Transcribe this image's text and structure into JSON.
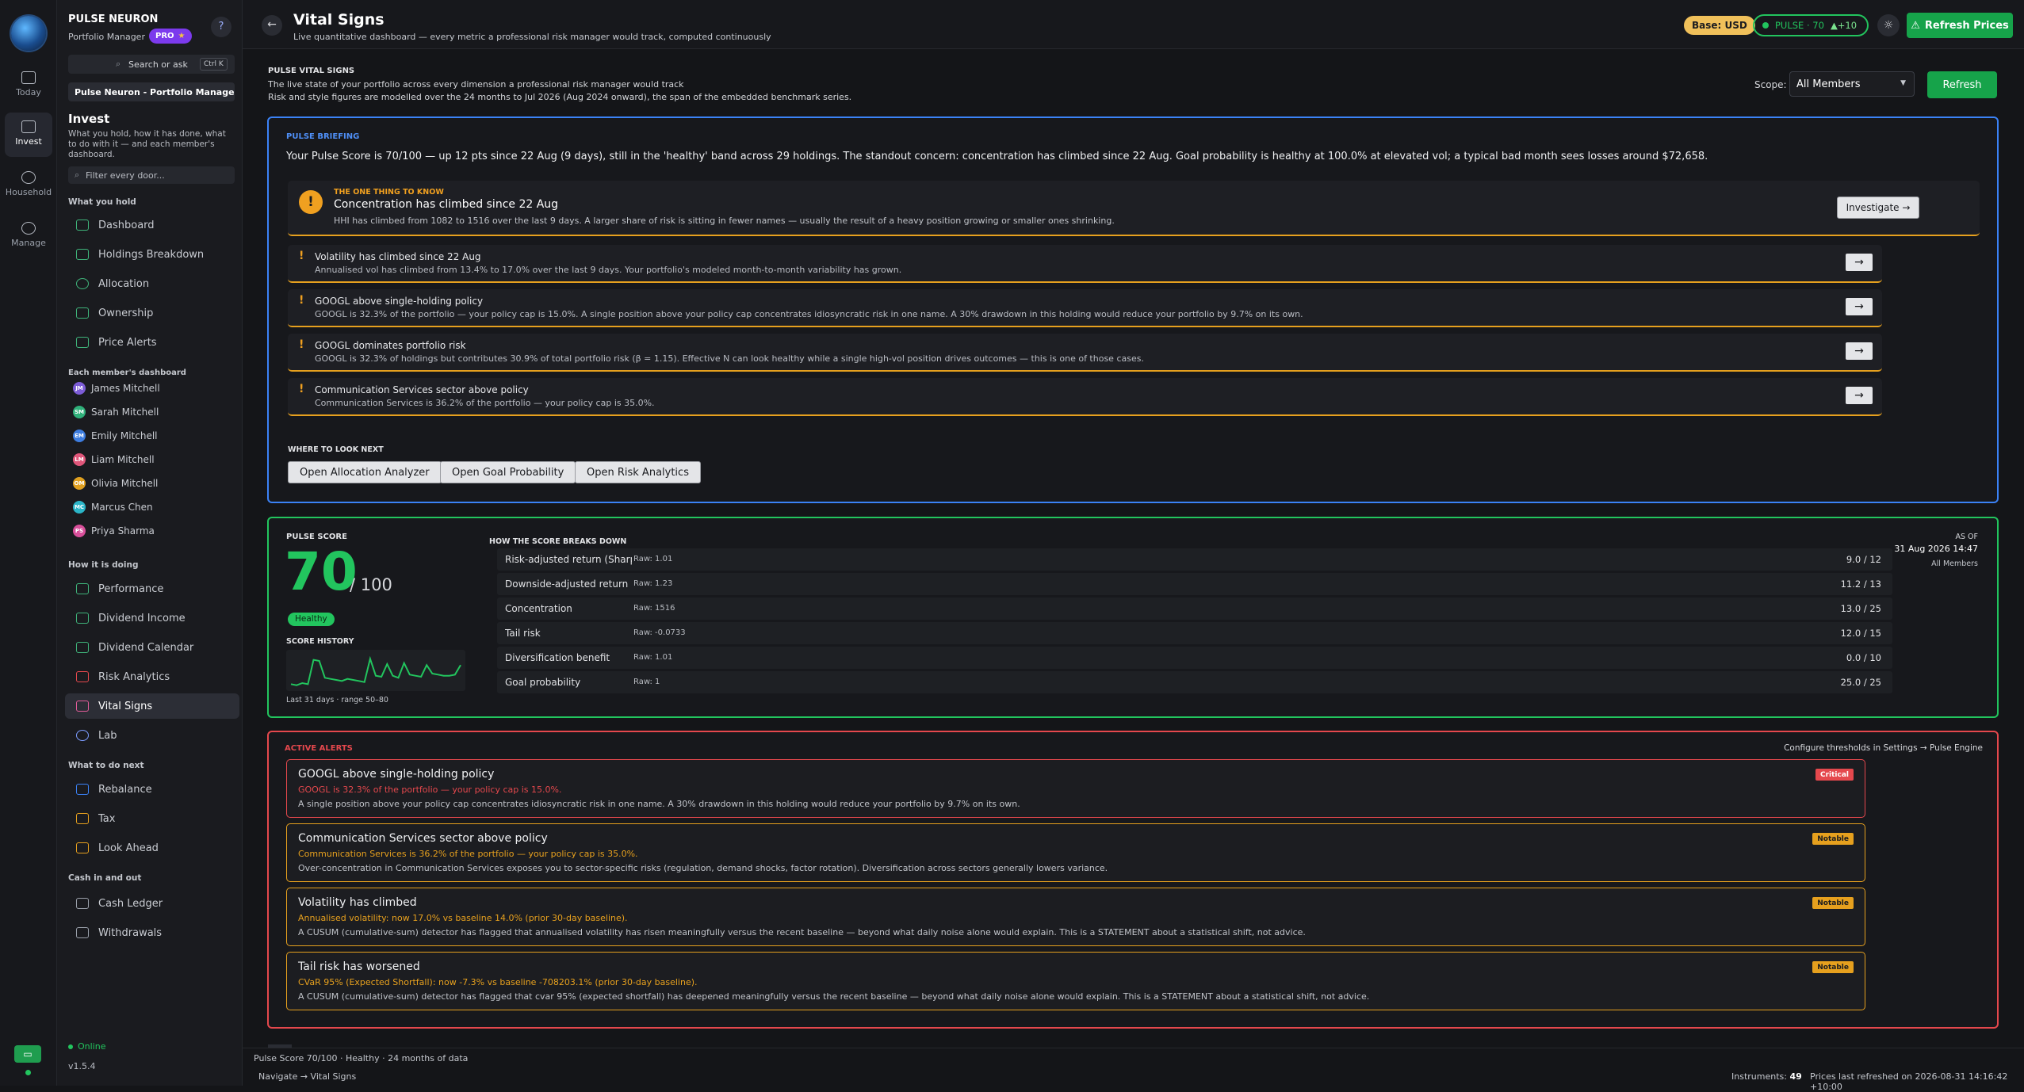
{
  "app": {
    "name": "PULSE NEURON",
    "role": "Portfolio Manager",
    "plan": "PRO",
    "plan_icon": "★",
    "help": "?"
  },
  "rail": {
    "items": [
      {
        "label": "Today",
        "icon": "calendar-icon"
      },
      {
        "label": "Invest",
        "icon": "chart-icon"
      },
      {
        "label": "Household",
        "icon": "users-icon"
      },
      {
        "label": "Manage",
        "icon": "gear-icon"
      }
    ],
    "version": "v1.5.4",
    "status": "Online"
  },
  "sidebar": {
    "search_placeholder": "Search or ask",
    "search_shortcut": "Ctrl K",
    "workspace": "Pulse Neuron - Portfolio Manager...",
    "section_title": "Invest",
    "section_desc": "What you hold, how it has done, what to do with it — and each member's dashboard.",
    "filter_placeholder": "Filter every door...",
    "groups": [
      {
        "title": "What you hold",
        "items": [
          "Dashboard",
          "Holdings Breakdown",
          "Allocation",
          "Ownership",
          "Price Alerts"
        ]
      },
      {
        "title": "How it is doing",
        "items": [
          "Performance",
          "Dividend Income",
          "Dividend Calendar",
          "Risk Analytics",
          "Vital Signs",
          "Lab"
        ]
      },
      {
        "title": "What to do next",
        "items": [
          "Rebalance",
          "Tax",
          "Look Ahead"
        ]
      },
      {
        "title": "Cash in and out",
        "items": [
          "Cash Ledger",
          "Withdrawals"
        ]
      }
    ],
    "members_title": "Each member's dashboard",
    "members": [
      {
        "initials": "JM",
        "name": "James Mitchell",
        "color": "#7c5cd6"
      },
      {
        "initials": "SM",
        "name": "Sarah Mitchell",
        "color": "#2fb07a"
      },
      {
        "initials": "EM",
        "name": "Emily Mitchell",
        "color": "#3d7de0"
      },
      {
        "initials": "LM",
        "name": "Liam Mitchell",
        "color": "#e0567a"
      },
      {
        "initials": "OM",
        "name": "Olivia Mitchell",
        "color": "#e0a020"
      },
      {
        "initials": "MC",
        "name": "Marcus Chen",
        "color": "#2bb5c8"
      },
      {
        "initials": "PS",
        "name": "Priya Sharma",
        "color": "#d84f9a"
      }
    ]
  },
  "header": {
    "title": "Vital Signs",
    "subtitle": "Live quantitative dashboard — every metric a professional risk manager would track, computed continuously",
    "base": "Base: USD",
    "pulse": "PULSE · 70",
    "pulse_delta": "▲+10",
    "refresh_prices": "Refresh Prices"
  },
  "intro": {
    "eyebrow": "PULSE VITAL SIGNS",
    "line1": "The live state of your portfolio across every dimension a professional risk manager would track",
    "line2": "Risk and style figures are modelled over the 24 months to Jul 2026 (Aug 2024 onward), the span of the embedded benchmark series.",
    "scope_label": "Scope:",
    "scope_value": "All Members",
    "refresh": "Refresh"
  },
  "briefing": {
    "eyebrow": "PULSE BRIEFING",
    "summary": "Your Pulse Score is 70/100 — up 12 pts since 22 Aug (9 days), still in the 'healthy' band across 29 holdings. The standout concern: concentration has climbed since 22 Aug. Goal probability is healthy at 100.0% at elevated vol; a typical bad month sees losses around $72,658.",
    "top_eyebrow": "THE ONE THING TO KNOW",
    "top_title": "Concentration has climbed since 22 Aug",
    "top_desc": "HHI has climbed from 1082 to 1516 over the last 9 days. A larger share of risk is sitting in fewer names — usually the result of a heavy position growing or smaller ones shrinking.",
    "investigate": "Investigate →",
    "notes": [
      {
        "title": "Volatility has climbed since 22 Aug",
        "desc": "Annualised vol has climbed from 13.4% to 17.0% over the last 9 days. Your portfolio's modeled month-to-month variability has grown."
      },
      {
        "title": "GOOGL above single-holding policy",
        "desc": "GOOGL is 32.3% of the portfolio — your policy cap is 15.0%. A single position above your policy cap concentrates idiosyncratic risk in one name. A 30% drawdown in this holding would reduce your portfolio by 9.7% on its own."
      },
      {
        "title": "GOOGL dominates portfolio risk",
        "desc": "GOOGL is 32.3% of holdings but contributes 30.9% of total portfolio risk (β = 1.15). Effective N can look healthy while a single high-vol position drives outcomes — this is one of those cases."
      },
      {
        "title": "Communication Services sector above policy",
        "desc": "Communication Services is 36.2% of the portfolio — your policy cap is 35.0%."
      }
    ],
    "arrow": "→",
    "next_title": "WHERE TO LOOK NEXT",
    "next_buttons": [
      "Open Allocation Analyzer",
      "Open Goal Probability",
      "Open Risk Analytics"
    ]
  },
  "score": {
    "eyebrow": "PULSE SCORE",
    "value": "70",
    "max": "/ 100",
    "band": "Healthy",
    "history_title": "SCORE HISTORY",
    "history_caption": "Last 31 days · range 50–80",
    "history": [
      52,
      51,
      53,
      52,
      75,
      74,
      58,
      57,
      56,
      55,
      57,
      56,
      55,
      54,
      76,
      60,
      59,
      71,
      60,
      58,
      72,
      61,
      60,
      59,
      70,
      62,
      61,
      60,
      60,
      61,
      70
    ],
    "breakdown_title": "HOW THE SCORE BREAKS DOWN",
    "raw_label": "Raw:",
    "rows": [
      {
        "label": "Risk-adjusted return (Sharpe)",
        "raw": "1.01",
        "score": "9.0",
        "max": "12"
      },
      {
        "label": "Downside-adjusted return (Sortino)",
        "raw": "1.23",
        "score": "11.2",
        "max": "13"
      },
      {
        "label": "Concentration",
        "raw": "1516",
        "score": "13.0",
        "max": "25"
      },
      {
        "label": "Tail risk",
        "raw": "-0.0733",
        "score": "12.0",
        "max": "15"
      },
      {
        "label": "Diversification benefit",
        "raw": "1.01",
        "score": "0.0",
        "max": "10"
      },
      {
        "label": "Goal probability",
        "raw": "1",
        "score": "25.0",
        "max": "25"
      }
    ],
    "as_of_label": "AS OF",
    "as_of": "31 Aug 2026 14:47",
    "as_of_scope": "All Members"
  },
  "alerts": {
    "eyebrow": "ACTIVE ALERTS",
    "configure": "Configure thresholds in Settings → Pulse Engine",
    "items": [
      {
        "title": "GOOGL above single-holding policy",
        "line1": "GOOGL is 32.3% of the portfolio — your policy cap is 15.0%.",
        "line2": "A single position above your policy cap concentrates idiosyncratic risk in one name. A 30% drawdown in this holding would reduce your portfolio by 9.7% on its own.",
        "badge": "Critical",
        "color": "#e5484d"
      },
      {
        "title": "Communication Services sector above policy",
        "line1": "Communication Services is 36.2% of the portfolio — your policy cap is 35.0%.",
        "line2": "Over-concentration in Communication Services exposes you to sector-specific risks (regulation, demand shocks, factor rotation). Diversification across sectors generally lowers variance.",
        "badge": "Notable",
        "color": "#e6a01e"
      },
      {
        "title": "Volatility has climbed",
        "line1": "Annualised volatility: now 17.0% vs baseline 14.0% (prior 30-day baseline).",
        "line2": "A CUSUM (cumulative-sum) detector has flagged that annualised volatility has risen meaningfully versus the recent baseline — beyond what daily noise alone would explain. This is a STATEMENT about a statistical shift, not advice.",
        "badge": "Notable",
        "color": "#e6a01e"
      },
      {
        "title": "Tail risk has worsened",
        "line1": "CVaR 95% (Expected Shortfall): now -7.3% vs baseline -708203.1% (prior 30-day baseline).",
        "line2": "A CUSUM (cumulative-sum) detector has flagged that cvar 95% (expected shortfall) has deepened meaningfully versus the recent baseline — beyond what daily noise alone would explain. This is a STATEMENT about a statistical shift, not advice.",
        "badge": "Notable",
        "color": "#e6a01e"
      }
    ]
  },
  "statusbar": {
    "line1": "Pulse Score 70/100 · Healthy · 24 months of data",
    "line2": "Navigate → Vital Signs",
    "instruments_label": "Instruments:",
    "instruments": "49",
    "last_refreshed": "Prices last refreshed on 2026-08-31 14:16:42 +10:00"
  },
  "colors": {
    "green": "#22c55e",
    "blue": "#3b82f6",
    "red": "#e5484d",
    "amber": "#e6a01e",
    "gold": "#f0c05a"
  }
}
